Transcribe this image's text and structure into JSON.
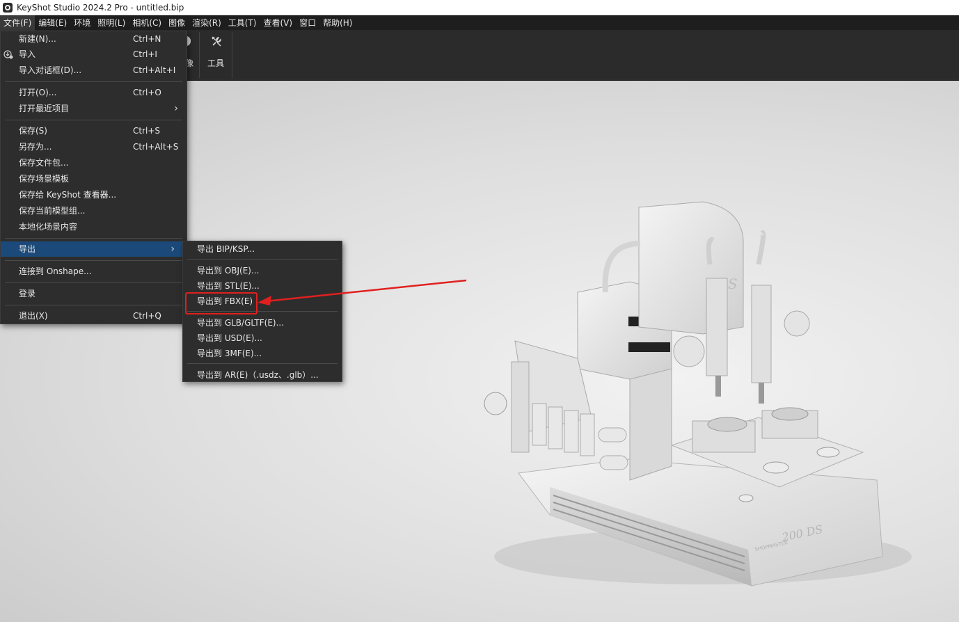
{
  "window": {
    "title": "KeyShot Studio 2024.2 Pro  - untitled.bip"
  },
  "menubar": {
    "items": [
      "文件(F)",
      "编辑(E)",
      "环境",
      "照明(L)",
      "相机(C)",
      "图像",
      "渲染(R)",
      "工具(T)",
      "查看(V)",
      "窗口",
      "帮助(H)"
    ]
  },
  "toolbar": {
    "partial_label": "像",
    "tools_label": "工具"
  },
  "file_menu": {
    "items": [
      {
        "label": "新建(N)...",
        "shortcut": "Ctrl+N"
      },
      {
        "label": "导入",
        "shortcut": "Ctrl+I"
      },
      {
        "label": "导入对话框(D)...",
        "shortcut": "Ctrl+Alt+I"
      },
      {
        "label": "打开(O)...",
        "shortcut": "Ctrl+O"
      },
      {
        "label": "打开最近项目",
        "shortcut": ""
      },
      {
        "label": "保存(S)",
        "shortcut": "Ctrl+S"
      },
      {
        "label": "另存为...",
        "shortcut": "Ctrl+Alt+S"
      },
      {
        "label": "保存文件包...",
        "shortcut": ""
      },
      {
        "label": "保存场景模板",
        "shortcut": ""
      },
      {
        "label": "保存给 KeyShot 查看器...",
        "shortcut": ""
      },
      {
        "label": "保存当前模型组...",
        "shortcut": ""
      },
      {
        "label": "本地化场景内容",
        "shortcut": ""
      },
      {
        "label": "导出",
        "shortcut": ""
      },
      {
        "label": "连接到 Onshape...",
        "shortcut": ""
      },
      {
        "label": "登录",
        "shortcut": ""
      },
      {
        "label": "退出(X)",
        "shortcut": "Ctrl+Q"
      }
    ]
  },
  "export_menu": {
    "items": [
      "导出 BIP/KSP...",
      "导出到 OBJ(E)...",
      "导出到 STL(E)...",
      "导出到 FBX(E)",
      "导出到 GLB/GLTF(E)...",
      "导出到 USD(E)...",
      "导出到 3MF(E)...",
      "导出到 AR(E)（.usdz、.glb）..."
    ]
  },
  "model": {
    "brand_text": "SHOPMASTER",
    "model_text": "200 DS",
    "head_text": "DS"
  },
  "colors": {
    "highlight": "#1b4a7a",
    "annotation": "#e0201e"
  }
}
